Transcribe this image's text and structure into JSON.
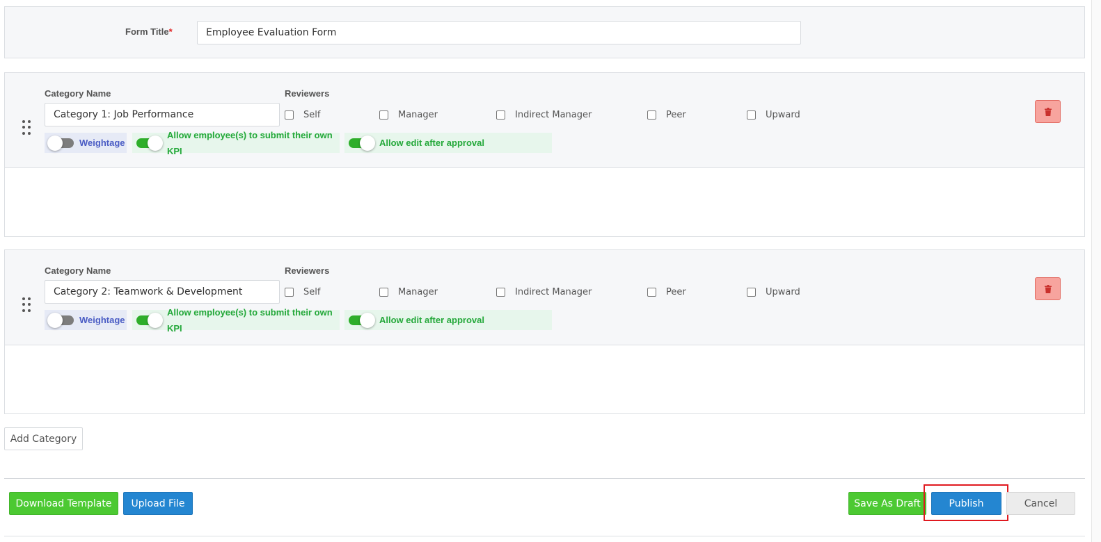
{
  "form": {
    "title_label": "Form Title",
    "required_mark": "*",
    "title_value": "Employee Evaluation Form"
  },
  "categories": [
    {
      "name_label": "Category Name",
      "name_value": "Category 1: Job Performance",
      "reviewers_label": "Reviewers",
      "reviewers": [
        "Self",
        "Manager",
        "Indirect Manager",
        "Peer",
        "Upward"
      ],
      "reviewers_checked": [
        false,
        false,
        false,
        false,
        false
      ],
      "weightage_label": "Weightage",
      "weightage_on": false,
      "kpi_label": "Allow employee(s) to submit their own KPI",
      "kpi_on": true,
      "edit_label": "Allow edit after approval",
      "edit_on": true
    },
    {
      "name_label": "Category Name",
      "name_value": "Category 2: Teamwork & Development",
      "reviewers_label": "Reviewers",
      "reviewers": [
        "Self",
        "Manager",
        "Indirect Manager",
        "Peer",
        "Upward"
      ],
      "reviewers_checked": [
        false,
        false,
        false,
        false,
        false
      ],
      "weightage_label": "Weightage",
      "weightage_on": false,
      "kpi_label": "Allow employee(s) to submit their own KPI",
      "kpi_on": true,
      "edit_label": "Allow edit after approval",
      "edit_on": true
    }
  ],
  "actions": {
    "add_category": "Add Category",
    "download_template": "Download Template",
    "upload_file": "Upload File",
    "save_as_draft": "Save As Draft",
    "publish": "Publish",
    "cancel": "Cancel"
  },
  "icons": {
    "drag": "drag-handle-icon",
    "delete": "trash-icon"
  },
  "colors": {
    "green": "#4cc932",
    "blue": "#2486d1",
    "danger": "#f7a49e",
    "toggle_on": "#2eae2a",
    "highlight": "#e0191f"
  }
}
